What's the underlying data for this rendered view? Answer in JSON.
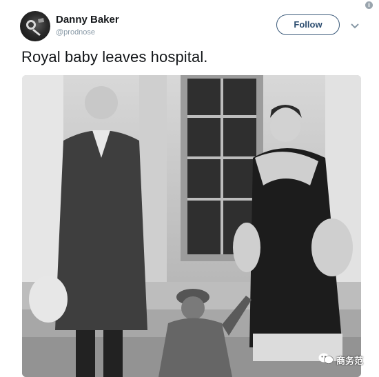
{
  "tweet": {
    "author_name": "Danny Baker",
    "author_handle": "@prodnose",
    "follow_label": "Follow",
    "text": "Royal baby leaves hospital."
  },
  "icons": {
    "avatar": "profile-avatar",
    "menu": "chevron-down-icon",
    "info": "info-icon",
    "watermark": "wechat-icon"
  },
  "watermark": {
    "text": "商务范"
  },
  "colors": {
    "follow_border": "#3b5a7a",
    "follow_text": "#2b4c6f",
    "handle_gray": "#8899a6"
  }
}
